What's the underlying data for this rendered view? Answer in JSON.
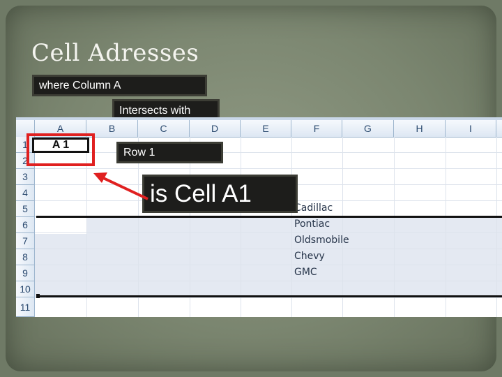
{
  "slide": {
    "title": "Cell Adresses",
    "labels": {
      "where": "where  Column A",
      "intersects": "Intersects with",
      "row": "Row   1",
      "result": "is Cell   A1",
      "a1_cell": "A 1"
    }
  },
  "sheet": {
    "columns": [
      "A",
      "B",
      "C",
      "D",
      "E",
      "F",
      "G",
      "H",
      "I"
    ],
    "rows": [
      "1",
      "2",
      "3",
      "4",
      "5",
      "6",
      "7",
      "8",
      "9",
      "10",
      "11"
    ],
    "column_f_values": [
      "Cadillac",
      "Pontiac",
      "Oldsmobile",
      "Chevy",
      "GMC"
    ]
  },
  "colors": {
    "highlight": "#e02020",
    "header_text": "#2b4a6f",
    "label_bg": "#1d1d1b"
  }
}
